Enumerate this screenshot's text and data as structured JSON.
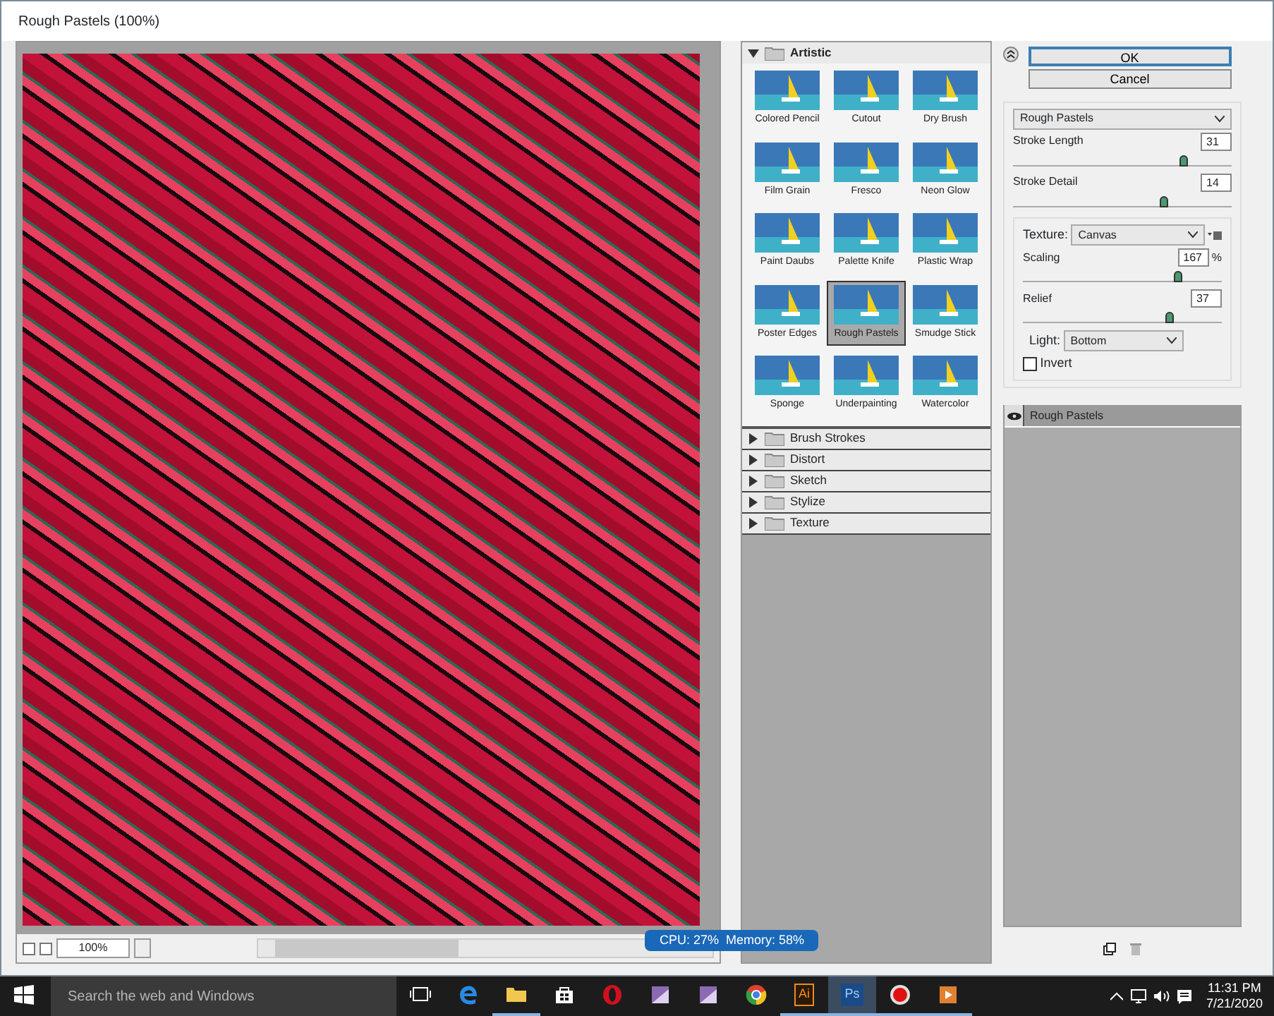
{
  "window": {
    "title": "Rough Pastels (100%)"
  },
  "preview": {
    "zoom": "100%",
    "status": "CPU: 27%  Memory: 58%"
  },
  "filter_gallery": {
    "categories": [
      {
        "name": "Artistic",
        "expanded": true,
        "filters": [
          {
            "name": "Colored Pencil",
            "selected": false
          },
          {
            "name": "Cutout",
            "selected": false
          },
          {
            "name": "Dry Brush",
            "selected": false
          },
          {
            "name": "Film Grain",
            "selected": false
          },
          {
            "name": "Fresco",
            "selected": false
          },
          {
            "name": "Neon Glow",
            "selected": false
          },
          {
            "name": "Paint Daubs",
            "selected": false
          },
          {
            "name": "Palette Knife",
            "selected": false
          },
          {
            "name": "Plastic Wrap",
            "selected": false
          },
          {
            "name": "Poster Edges",
            "selected": false
          },
          {
            "name": "Rough Pastels",
            "selected": true
          },
          {
            "name": "Smudge Stick",
            "selected": false
          },
          {
            "name": "Sponge",
            "selected": false
          },
          {
            "name": "Underpainting",
            "selected": false
          },
          {
            "name": "Watercolor",
            "selected": false
          }
        ]
      },
      {
        "name": "Brush Strokes",
        "expanded": false
      },
      {
        "name": "Distort",
        "expanded": false
      },
      {
        "name": "Sketch",
        "expanded": false
      },
      {
        "name": "Stylize",
        "expanded": false
      },
      {
        "name": "Texture",
        "expanded": false
      }
    ]
  },
  "buttons": [
    "OK",
    "Cancel"
  ],
  "settings": {
    "filter": "Rough Pastels",
    "sliders": [
      {
        "label": "Stroke Length",
        "value": "31",
        "level": 0.78
      },
      {
        "label": "Stroke Detail",
        "value": "14",
        "level": 0.69
      }
    ],
    "texture": {
      "label": "Texture:",
      "value": "Canvas",
      "sliders": [
        {
          "label": "Scaling",
          "value": "167",
          "unit": "%",
          "level": 0.78
        },
        {
          "label": "Relief",
          "value": "37",
          "level": 0.74
        }
      ],
      "light": {
        "label": "Light:",
        "value": "Bottom"
      },
      "invert": {
        "label": "Invert",
        "checked": false
      }
    }
  },
  "effect_layers": [
    {
      "name": "Rough Pastels",
      "visible": true
    }
  ],
  "taskbar": {
    "search_placeholder": "Search the web and Windows",
    "apps": [
      {
        "kind": "taskview",
        "running": false
      },
      {
        "kind": "edge",
        "running": false
      },
      {
        "kind": "folder",
        "running": true
      },
      {
        "kind": "store",
        "running": false
      },
      {
        "kind": "opera",
        "running": false
      },
      {
        "kind": "purple",
        "running": false
      },
      {
        "kind": "purple",
        "running": false
      },
      {
        "kind": "chrome",
        "running": false
      },
      {
        "kind": "ai",
        "label": "Ai",
        "running": true
      },
      {
        "kind": "ps",
        "label": "Ps",
        "running": true
      },
      {
        "kind": "record",
        "running": true
      },
      {
        "kind": "media",
        "running": true
      }
    ],
    "time": "11:31 PM",
    "date": "7/21/2020"
  }
}
